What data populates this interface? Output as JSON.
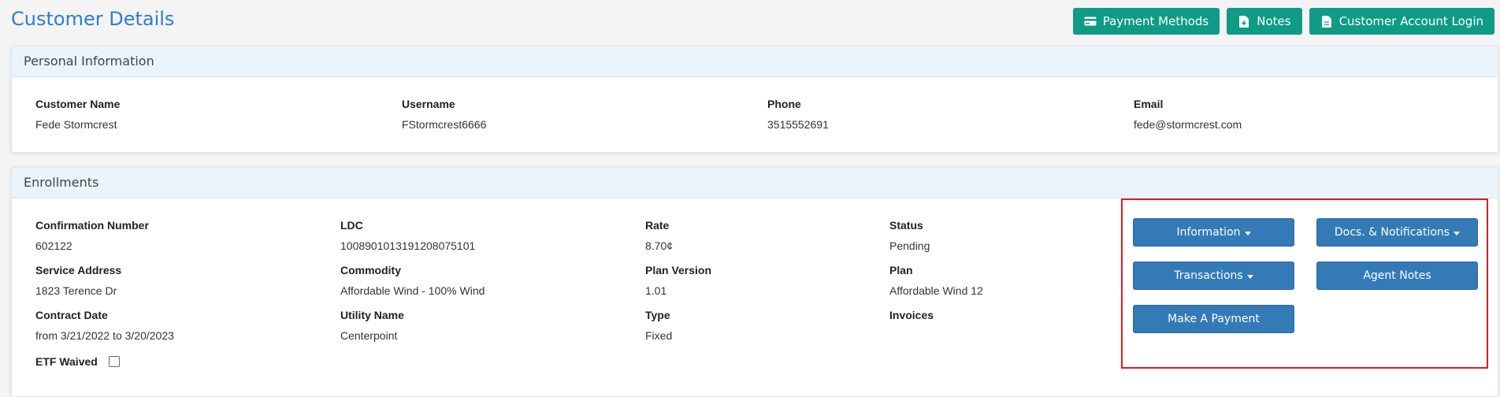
{
  "page": {
    "title": "Customer Details"
  },
  "top_actions": {
    "payment_methods": "Payment Methods",
    "notes": "Notes",
    "customer_login": "Customer Account Login"
  },
  "personal": {
    "heading": "Personal Information",
    "customer_name": {
      "label": "Customer Name",
      "value": "Fede Stormcrest"
    },
    "username": {
      "label": "Username",
      "value": "FStormcrest6666"
    },
    "phone": {
      "label": "Phone",
      "value": "3515552691"
    },
    "email": {
      "label": "Email",
      "value": "fede@stormcrest.com"
    }
  },
  "enrollments": {
    "heading": "Enrollments",
    "confirmation": {
      "label": "Confirmation Number",
      "value": "602122"
    },
    "ldc": {
      "label": "LDC",
      "value": "1008901013191208075101"
    },
    "rate": {
      "label": "Rate",
      "value": "8.70¢"
    },
    "status": {
      "label": "Status",
      "value": "Pending"
    },
    "service_address": {
      "label": "Service Address",
      "value": "1823 Terence Dr"
    },
    "commodity": {
      "label": "Commodity",
      "value": "Affordable Wind - 100% Wind"
    },
    "plan_version": {
      "label": "Plan Version",
      "value": "1.01"
    },
    "plan": {
      "label": "Plan",
      "value": "Affordable Wind 12"
    },
    "contract_date": {
      "label": "Contract Date",
      "value": "from 3/21/2022 to 3/20/2023"
    },
    "utility_name": {
      "label": "Utility Name",
      "value": "Centerpoint"
    },
    "type": {
      "label": "Type",
      "value": "Fixed"
    },
    "invoices": {
      "label": "Invoices"
    },
    "etf_waived": {
      "label": "ETF Waived",
      "checked": false
    },
    "actions": {
      "information": "Information",
      "docs_notifications": "Docs. & Notifications",
      "transactions": "Transactions",
      "agent_notes": "Agent Notes",
      "make_payment": "Make A Payment"
    }
  }
}
